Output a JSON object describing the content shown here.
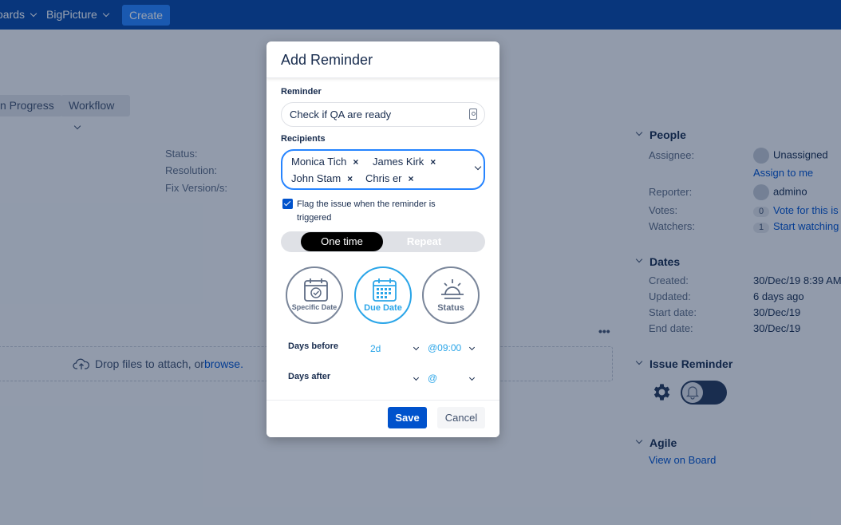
{
  "nav": {
    "boards_label": "oards",
    "bigpicture_label": "BigPicture",
    "create_label": "Create"
  },
  "toolbar": {
    "in_progress_label": "n Progress",
    "workflow_label": "Workflow"
  },
  "details": {
    "status_label": "Status:",
    "resolution_label": "Resolution:",
    "fix_version_label": "Fix Version/s:"
  },
  "attachments": {
    "drop_text": "Drop files to attach, or ",
    "browse_link": "browse.",
    "more_label": "•••"
  },
  "people": {
    "heading": "People",
    "assignee_label": "Assignee:",
    "assignee_value": "Unassigned",
    "assign_to_me": "Assign to me",
    "reporter_label": "Reporter:",
    "reporter_value": "admino",
    "votes_label": "Votes:",
    "votes_count": "0",
    "votes_link": "Vote for this is",
    "watchers_label": "Watchers:",
    "watchers_count": "1",
    "watchers_link": "Start watching"
  },
  "dates": {
    "heading": "Dates",
    "created_label": "Created:",
    "created_value": "30/Dec/19 8:39 AM",
    "updated_label": "Updated:",
    "updated_value": "6 days ago",
    "start_label": "Start date:",
    "start_value": "30/Dec/19",
    "end_label": "End date:",
    "end_value": "30/Dec/19"
  },
  "issue_reminder": {
    "heading": "Issue Reminder"
  },
  "agile": {
    "heading": "Agile",
    "view_on_board": "View on Board"
  },
  "modal": {
    "title": "Add Reminder",
    "reminder_label": "Reminder",
    "reminder_value": "Check if QA are ready",
    "recipients_label": "Recipients",
    "recipients": [
      {
        "name": "Monica Tich"
      },
      {
        "name": "James Kirk"
      },
      {
        "name": "John Stam"
      },
      {
        "name": "Chris er"
      }
    ],
    "remove_glyph": "×",
    "flag_text": "Flag the issue when the reminder is triggered",
    "flag_checked": true,
    "one_time_label": "One time",
    "repeat_label": "Repeat",
    "types": {
      "specific_date": "Specific Date",
      "due_date": "Due Date",
      "status": "Status"
    },
    "selected_type": "Due Date",
    "days_before_label": "Days before",
    "days_before_value": "2d",
    "days_before_time": "@09:00",
    "days_after_label": "Days after",
    "days_after_value": "",
    "days_after_time": "@",
    "save_label": "Save",
    "cancel_label": "Cancel"
  },
  "colors": {
    "nav_bg": "#0747a6",
    "primary": "#0052cc",
    "accent": "#2aa5e8",
    "overlay": "#091e42"
  }
}
